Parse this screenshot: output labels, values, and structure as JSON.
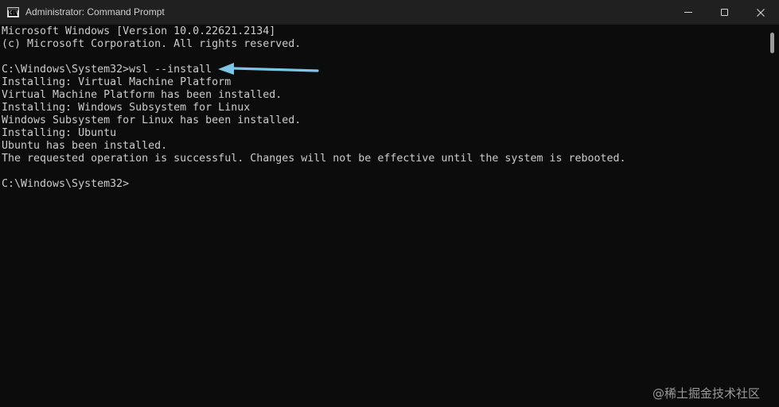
{
  "window": {
    "title": "Administrator: Command Prompt",
    "icon": "command-prompt-icon",
    "icon_text": "C:\\",
    "controls": [
      "minimize-icon",
      "maximize-icon",
      "close-icon"
    ]
  },
  "console": {
    "lines": [
      "Microsoft Windows [Version 10.0.22621.2134]",
      "(c) Microsoft Corporation. All rights reserved.",
      "",
      "C:\\Windows\\System32>wsl --install",
      "Installing: Virtual Machine Platform",
      "Virtual Machine Platform has been installed.",
      "Installing: Windows Subsystem for Linux",
      "Windows Subsystem for Linux has been installed.",
      "Installing: Ubuntu",
      "Ubuntu has been installed.",
      "The requested operation is successful. Changes will not be effective until the system is rebooted.",
      "",
      "C:\\Windows\\System32>"
    ]
  },
  "annotation": {
    "icon": "arrow-left-icon",
    "color": "#7cc7e6"
  },
  "watermark": {
    "text": "@稀土掘金技术社区"
  },
  "colors": {
    "background": "#0c0c0c",
    "titlebar": "#202020",
    "text": "#cccccc"
  }
}
